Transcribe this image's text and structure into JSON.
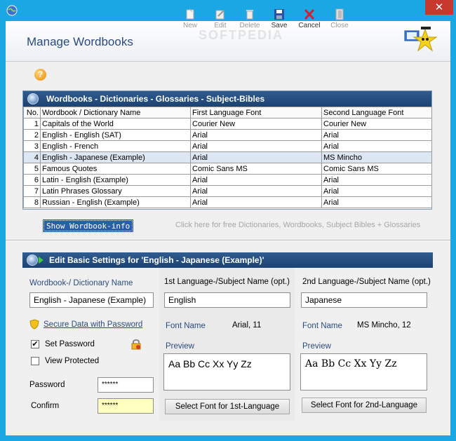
{
  "window": {
    "close_glyph": "✕"
  },
  "header": {
    "title": "Manage Wordbooks",
    "watermark": "SOFTPEDIA",
    "toolbar": {
      "new": "New",
      "edit": "Edit",
      "delete": "Delete",
      "save": "Save",
      "cancel": "Cancel",
      "close": "Close"
    }
  },
  "help": {
    "glyph": "?"
  },
  "wordbooks_panel": {
    "title": "Wordbooks - Dictionaries - Glossaries - Subject-Bibles",
    "columns": [
      "No.",
      "Wordbook / Dictionary Name",
      "First Language Font",
      "Second Language Font"
    ],
    "rows": [
      {
        "no": "1",
        "name": "Capitals of the World",
        "first_font": "Courier New",
        "second_font": "Courier New"
      },
      {
        "no": "2",
        "name": "English - English  (SAT)",
        "first_font": "Arial",
        "second_font": "Arial"
      },
      {
        "no": "3",
        "name": "English - French",
        "first_font": "Arial",
        "second_font": "Arial"
      },
      {
        "no": "4",
        "name": "English - Japanese  (Example)",
        "first_font": "Arial",
        "second_font": "MS Mincho"
      },
      {
        "no": "5",
        "name": "Famous Quotes",
        "first_font": "Comic Sans MS",
        "second_font": "Comic Sans MS"
      },
      {
        "no": "6",
        "name": "Latin - English  (Example)",
        "first_font": "Arial",
        "second_font": "Arial"
      },
      {
        "no": "7",
        "name": "Latin Phrases Glossary",
        "first_font": "Arial",
        "second_font": "Arial"
      },
      {
        "no": "8",
        "name": "Russian - English  (Example)",
        "first_font": "Arial",
        "second_font": "Arial"
      }
    ],
    "selected_row": 3
  },
  "show_info_button": "Show Wordbook-info",
  "free_link": "Click here for free Dictionaries, Wordbooks, Subject Bibles + Glossaries",
  "settings": {
    "title": "Edit Basic Settings for 'English - Japanese  (Example)'",
    "name_label": "Wordbook-/ Dictionary Name",
    "name_value": "English - Japanese  (Example)",
    "secure_link": "Secure Data with Password",
    "set_password_label": "Set Password",
    "set_password_checked": true,
    "view_protected_label": "View Protected",
    "view_protected_checked": false,
    "password_label": "Password",
    "password_value": "******",
    "confirm_label": "Confirm",
    "confirm_value": "******",
    "lang1": {
      "label": "1st Language-/Subject Name  (opt.)",
      "value": "English",
      "font_label": "Font Name",
      "font_value": "Arial, 11",
      "preview_label": "Preview",
      "preview_text": "Aa Bb Cc  Xx Yy Zz",
      "button": "Select  Font  for 1st-Language"
    },
    "lang2": {
      "label": "2nd Language-/Subject Name  (opt.)",
      "value": "Japanese",
      "font_label": "Font Name",
      "font_value": "MS Mincho, 12",
      "preview_label": "Preview",
      "preview_text": "Aa  Bb  Cc    Xx  Yy  Zz",
      "button": "Select Font for 2nd-Language"
    }
  },
  "colors": {
    "titlebar": "#1ba7e3",
    "panel_header": "#1d4273",
    "selected_row": "#dde6f3",
    "link": "#2b4a80",
    "confirm_bg": "#ffffc0"
  },
  "icons": [
    "app-globe-icon",
    "new-icon",
    "edit-icon",
    "delete-icon",
    "save-icon",
    "cancel-icon",
    "close-icon",
    "mascot-icon",
    "help-icon",
    "globe-icon",
    "shield-icon",
    "lock-icon"
  ]
}
